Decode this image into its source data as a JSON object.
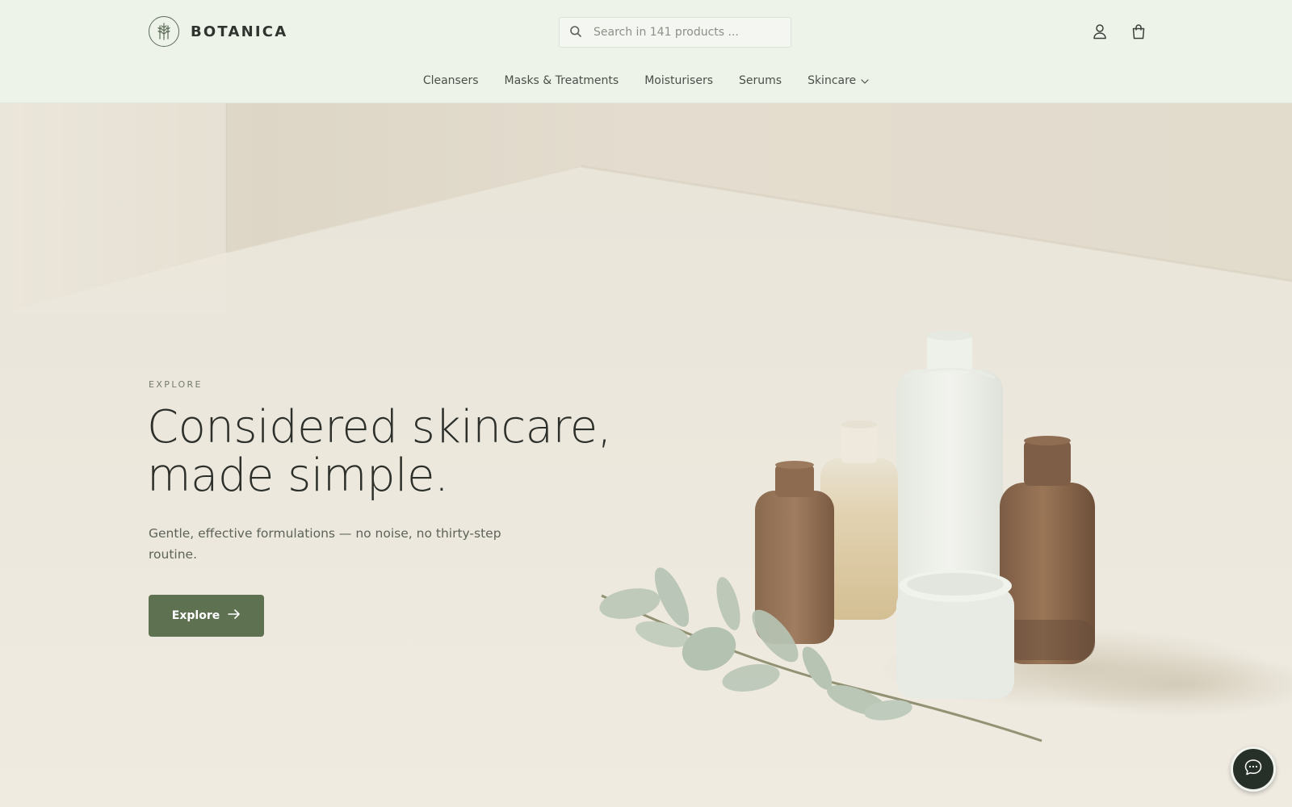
{
  "brand": {
    "name": "BOTANICA",
    "logo_icon": "leaf-bundle-logo"
  },
  "search": {
    "placeholder": "Search in 141 products ...",
    "value": ""
  },
  "header_icons": [
    {
      "name": "account-icon"
    },
    {
      "name": "cart-icon"
    }
  ],
  "nav": {
    "items": [
      {
        "label": "Cleansers"
      },
      {
        "label": "Masks & Treatments"
      },
      {
        "label": "Moisturisers"
      },
      {
        "label": "Serums"
      },
      {
        "label": "Skincare",
        "has_dropdown": true
      }
    ]
  },
  "hero": {
    "eyebrow": "EXPLORE",
    "title_line1": "Considered skincare,",
    "title_line2": "made simple.",
    "subtitle": "Gentle, effective formulations — no noise, no thirty-step routine.",
    "cta_label": "Explore"
  },
  "chat": {
    "icon": "chat-bubble-icon"
  },
  "colors": {
    "header_bg": "#eef3ea",
    "accent": "#5e7150",
    "chat_bg": "#263029"
  }
}
